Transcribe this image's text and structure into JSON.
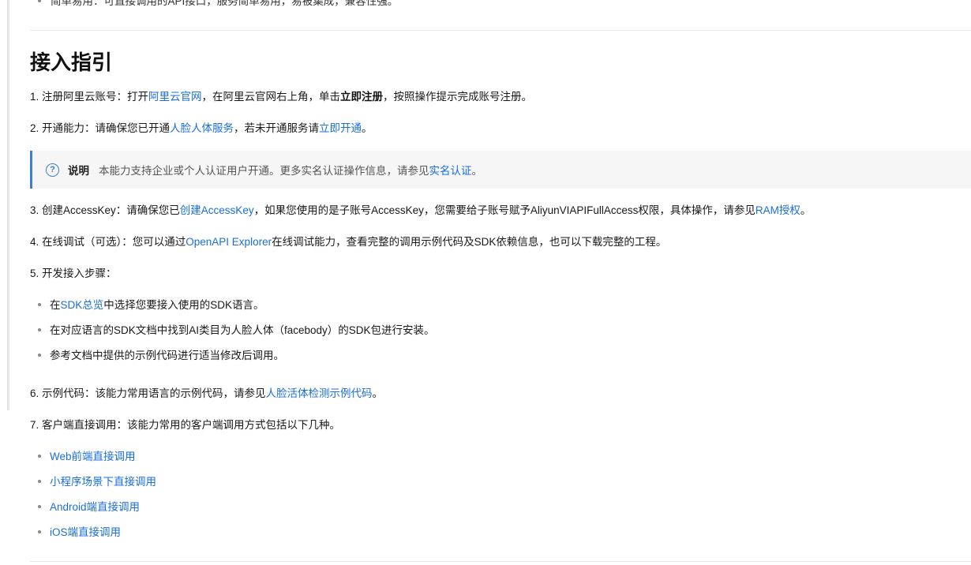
{
  "top_bullet": "简单易用：可直接调用的API接口，服务简单易用，易被集成，兼容性强。",
  "heading": "接入指引",
  "step1": {
    "a": "1. 注册阿里云账号：打开",
    "link1": "阿里云官网",
    "b": "，在阿里云官网右上角，单击",
    "bold": "立即注册",
    "c": "，按照操作提示完成账号注册。"
  },
  "step2": {
    "a": "2. 开通能力：请确保您已开通",
    "link1": "人脸人体服务",
    "b": "，若未开通服务请",
    "link2": "立即开通",
    "c": "。"
  },
  "note": {
    "title": "说明",
    "text": "本能力支持企业或个人认证用户开通。更多实名认证操作信息，请参见",
    "link": "实名认证",
    "end": "。"
  },
  "step3": {
    "a": "3. 创建AccessKey：请确保您已",
    "link1": "创建AccessKey",
    "b": "，如果您使用的是子账号AccessKey，您需要给子账号赋予AliyunVIAPIFullAccess权限，具体操作，请参见",
    "link2": "RAM授权",
    "c": "。"
  },
  "step4": {
    "a": "4. 在线调试（可选）：您可以通过",
    "link1": "OpenAPI Explorer",
    "b": "在线调试能力，查看完整的调用示例代码及SDK依赖信息，也可以下载完整的工程。"
  },
  "step5": {
    "title": "5. 开发接入步骤：",
    "item1_a": "在",
    "item1_link": "SDK总览",
    "item1_b": "中选择您要接入使用的SDK语言。",
    "item2": "在对应语言的SDK文档中找到AI类目为人脸人体（facebody）的SDK包进行安装。",
    "item3": "参考文档中提供的示例代码进行适当修改后调用。"
  },
  "step6": {
    "a": "6. 示例代码：该能力常用语言的示例代码，请参见",
    "link1": "人脸活体检测示例代码",
    "b": "。"
  },
  "step7": {
    "title": "7. 客户端直接调用：该能力常用的客户端调用方式包括以下几种。",
    "links": [
      "Web前端直接调用",
      "小程序场景下直接调用",
      "Android端直接调用",
      "iOS端直接调用"
    ]
  },
  "colors": {
    "link": "#1a6ed9",
    "note_border": "#3f7ec9",
    "note_bg": "#f6f6f7"
  }
}
